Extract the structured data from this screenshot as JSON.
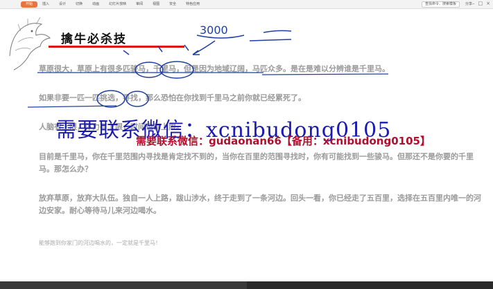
{
  "ribbon": {
    "tabs": [
      "开始",
      "插入",
      "设计",
      "切换",
      "动画",
      "幻灯片放映",
      "审阅",
      "视图",
      "安全",
      "特色应用"
    ],
    "search_label": "查找命令、搜索模板",
    "share_label": "分享"
  },
  "slide": {
    "title": "擒牛必杀技",
    "paragraphs": [
      "草原很大，草原上有很多匹骏马，千里马，但是因为地域辽阔，马匹众多。是在是难以分辨谁是千里马。",
      "如果非要一匹一匹挑选，寻找，那么恐怕在你找到千里马之前你就已经累死了。",
      "人脑有上限，体力有上限，时间也有上限。",
      "目前是千里马，你在千里范围内寻找是肯定找不到的，当你在百里的范围寻找时，你有可能找到一些骏马。但那还不是你要的千里马。那怎么办？",
      "放弃草原，放弃大队伍。独自一人上路，跋山涉水，终于走到了一条河边。回头一看，你已经走了五百里，选择在五百里内唯一的河边安家。耐心等待马儿来河边喝水。",
      "能够跑到你家门的河边喝水的，一定就是千里马！"
    ],
    "handwriting": "3000"
  },
  "watermark": {
    "line1": "需要联系微信：xcnibudong0105",
    "line2": "需要联系微信：gudaonan66【备用：xcnibudong0105】"
  },
  "colors": {
    "accent": "#e9743f",
    "ink": "#1f3fa0",
    "title_underline": "#dd1111",
    "wm_blue": "#1b1bb0",
    "wm_red": "#b10f2e"
  }
}
